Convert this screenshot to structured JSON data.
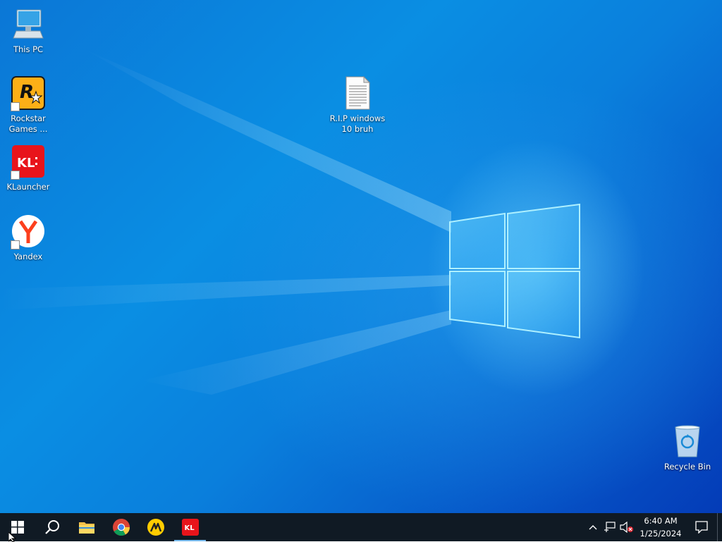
{
  "desktop": {
    "icons": [
      {
        "label": "This PC",
        "icon": "computer-icon"
      },
      {
        "label": "Rockstar\nGames ...",
        "icon": "rockstar-games-icon"
      },
      {
        "label": "KLauncher",
        "icon": "klauncher-icon"
      },
      {
        "label": "Yandex",
        "icon": "yandex-icon"
      },
      {
        "label": "R.I.P windows\n10 bruh",
        "icon": "text-document-icon"
      },
      {
        "label": "Recycle Bin",
        "icon": "recycle-bin-icon"
      }
    ],
    "rockstar_logo_text": "R",
    "klauncher_logo_text": "KL"
  },
  "taskbar": {
    "items": [
      {
        "name": "start",
        "icon": "windows-start-icon"
      },
      {
        "name": "search",
        "icon": "search-icon"
      },
      {
        "name": "file-explorer",
        "icon": "folder-icon"
      },
      {
        "name": "chrome",
        "icon": "chrome-icon"
      },
      {
        "name": "yandex-market",
        "icon": "yandex-market-icon"
      },
      {
        "name": "klauncher",
        "icon": "klauncher-icon",
        "active": true
      }
    ],
    "tray": {
      "time": "6:40 AM",
      "date": "1/25/2024",
      "icons": [
        "chevron-up-icon",
        "network-icon",
        "volume-muted-icon",
        "notification-icon"
      ]
    }
  },
  "colors": {
    "taskbar": "#101a24",
    "accent": "#76b9ed",
    "klauncher_red": "#e8141b",
    "rockstar_yellow": "#fcaf17"
  }
}
